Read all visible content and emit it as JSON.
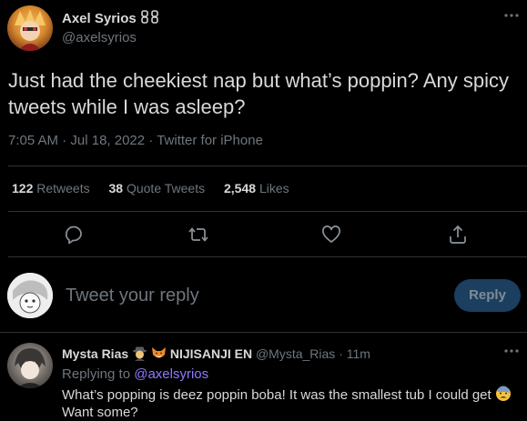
{
  "main_tweet": {
    "author_name": "Axel Syrios",
    "author_handle": "@axelsyrios",
    "text": "Just had the cheekiest nap but what’s poppin? Any spicy tweets while I was asleep?",
    "time": "7:05 AM",
    "date": "Jul 18, 2022",
    "source": "Twitter for iPhone",
    "stats": {
      "retweets_count": "122",
      "retweets_label": "Retweets",
      "quotes_count": "38",
      "quotes_label": "Quote Tweets",
      "likes_count": "2,548",
      "likes_label": "Likes"
    },
    "actions": [
      "reply-icon",
      "retweet-icon",
      "like-icon",
      "share-icon"
    ]
  },
  "composer": {
    "placeholder": "Tweet your reply",
    "button_label": "Reply"
  },
  "reply": {
    "author_name": "Mysta Rias",
    "affiliation": "NIJISANJI EN",
    "author_handle": "@Mysta_Rias",
    "separator": "·",
    "time_ago": "11m",
    "replying_to_label": "Replying to",
    "replying_to_handle": "@axelsyrios",
    "line1": "What’s popping is deez poppin boba! It was the smallest tub I could get",
    "line2": "Want some?"
  },
  "colors": {
    "background": "#000000",
    "text": "#d9d9d9",
    "muted": "#6e767d",
    "divider": "#2f3336",
    "accent": "#8c7bff",
    "reply_button_bg": "#1a3f5f"
  }
}
